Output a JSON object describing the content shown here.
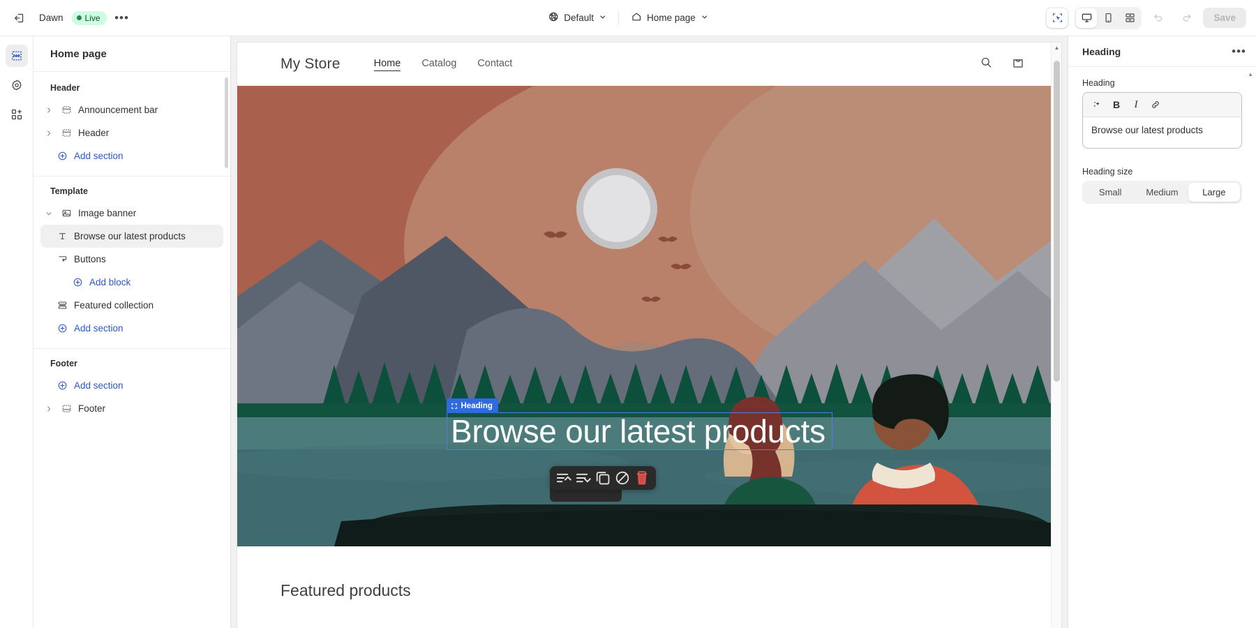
{
  "topbar": {
    "exit_icon": "exit-icon",
    "theme_name": "Dawn",
    "live_label": "Live",
    "more_label": "•••",
    "locale_icon": "globe-icon",
    "locale_value": "Default",
    "page_icon": "home-icon",
    "page_value": "Home page",
    "devices": [
      {
        "name": "inspect",
        "icon": "cursor-select-icon",
        "active": true
      },
      {
        "name": "desktop",
        "icon": "desktop-icon",
        "active": true
      },
      {
        "name": "mobile",
        "icon": "mobile-icon",
        "active": false
      },
      {
        "name": "fullscreen",
        "icon": "fullscreen-icon",
        "active": false
      }
    ],
    "undo_icon": "undo-icon",
    "redo_icon": "redo-icon",
    "save_label": "Save"
  },
  "rail": {
    "items": [
      {
        "name": "sections",
        "icon": "sections-icon",
        "active": true
      },
      {
        "name": "theme-settings",
        "icon": "gear-icon",
        "active": false
      },
      {
        "name": "apps",
        "icon": "apps-icon",
        "active": false
      }
    ]
  },
  "sidebar": {
    "title": "Home page",
    "groups": [
      {
        "label": "Header",
        "items": [
          {
            "label": "Announcement bar",
            "icon": "section-icon",
            "chevron": "right",
            "selected": false
          },
          {
            "label": "Header",
            "icon": "section-icon",
            "chevron": "right",
            "selected": false
          }
        ],
        "add_label": "Add section"
      },
      {
        "label": "Template",
        "items": [
          {
            "label": "Image banner",
            "icon": "image-icon",
            "chevron": "down",
            "selected": false
          },
          {
            "label": "Browse our latest products",
            "icon": "text-icon",
            "chevron": "none",
            "selected": true,
            "indent": true
          },
          {
            "label": "Buttons",
            "icon": "button-icon",
            "chevron": "none",
            "selected": false,
            "indent": true
          }
        ],
        "add_block_label": "Add block",
        "extra_items": [
          {
            "label": "Featured collection",
            "icon": "collection-icon",
            "chevron": "none",
            "selected": false
          }
        ],
        "add_label": "Add section"
      },
      {
        "label": "Footer",
        "add_label": "Add section",
        "items_after": [
          {
            "label": "Footer",
            "icon": "footer-icon",
            "chevron": "right",
            "selected": false
          }
        ]
      }
    ]
  },
  "preview": {
    "store_name": "My Store",
    "nav": [
      {
        "label": "Home",
        "active": true
      },
      {
        "label": "Catalog",
        "active": false
      },
      {
        "label": "Contact",
        "active": false
      }
    ],
    "search_icon": "search-icon",
    "cart_icon": "cart-icon",
    "hero_heading": "Browse our latest products",
    "selection_label": "Heading",
    "featured_title": "Featured products",
    "block_toolbar": [
      {
        "name": "move-up",
        "icon": "move-up-icon"
      },
      {
        "name": "move-down",
        "icon": "move-down-icon"
      },
      {
        "name": "duplicate",
        "icon": "duplicate-icon"
      },
      {
        "name": "hide",
        "icon": "hide-icon"
      },
      {
        "name": "delete",
        "icon": "trash-icon"
      }
    ]
  },
  "inspector": {
    "title": "Heading",
    "more_label": "•••",
    "heading_label": "Heading",
    "heading_value": "Browse our latest products",
    "rte_tools": [
      {
        "name": "ai-generate",
        "glyph": "✦"
      },
      {
        "name": "bold",
        "glyph": "B"
      },
      {
        "name": "italic",
        "glyph": "I"
      },
      {
        "name": "link",
        "glyph": "🔗"
      }
    ],
    "size_label": "Heading size",
    "size_options": [
      {
        "label": "Small",
        "active": false
      },
      {
        "label": "Medium",
        "active": false
      },
      {
        "label": "Large",
        "active": true
      }
    ]
  },
  "colors": {
    "accent": "#2b57c9",
    "selection": "#2f6ae1",
    "live_badge_bg": "#cdfee1",
    "live_badge_text": "#0c5132",
    "danger": "#e8554e"
  }
}
